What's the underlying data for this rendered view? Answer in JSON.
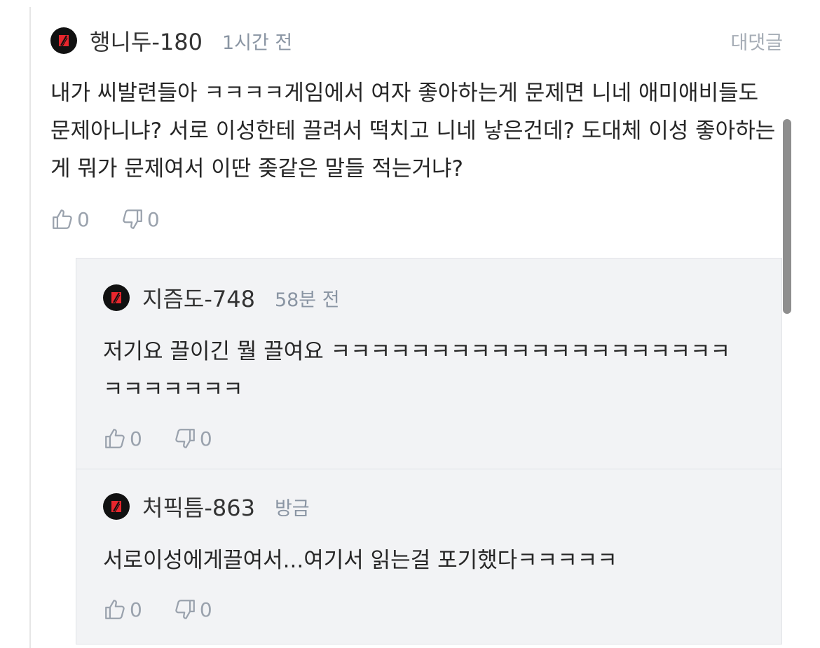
{
  "colors": {
    "avatar_bg": "#111111",
    "avatar_mark": "#e8262d",
    "meta_gray": "#8a95a3",
    "reply_bg": "#f2f3f5"
  },
  "comment": {
    "username": "행니두-180",
    "time": "1시간 전",
    "reply_label": "대댓글",
    "body": "내가 씨발련들아 ㅋㅋㅋㅋ게임에서 여자 좋아하는게 문제면 니네 애미애비들도 문제아니냐? 서로 이성한테 끌려서 떡치고 니네 낳은건데? 도대체 이성 좋아하는게 뭐가 문제여서 이딴 좆같은 말들 적는거냐?",
    "likes": "0",
    "dislikes": "0",
    "avatar_icon": "red-slash-logo-icon"
  },
  "replies": [
    {
      "username": "지즘도-748",
      "time": "58분 전",
      "body": "저기요 끌이긴 뭘 끌여요 ㅋㅋㅋㅋㅋㅋㅋㅋㅋㅋㅋㅋㅋㅋㅋㅋㅋㅋㅋㅋㅋㅋㅋㅋㅋㅋㅋ",
      "likes": "0",
      "dislikes": "0"
    },
    {
      "username": "처픽틈-863",
      "time": "방금",
      "body": "서로이성에게끌여서...여기서 읽는걸 포기했다ㅋㅋㅋㅋㅋ",
      "likes": "0",
      "dislikes": "0"
    }
  ],
  "icons": {
    "like": "thumbs-up-icon",
    "dislike": "thumbs-down-icon"
  }
}
